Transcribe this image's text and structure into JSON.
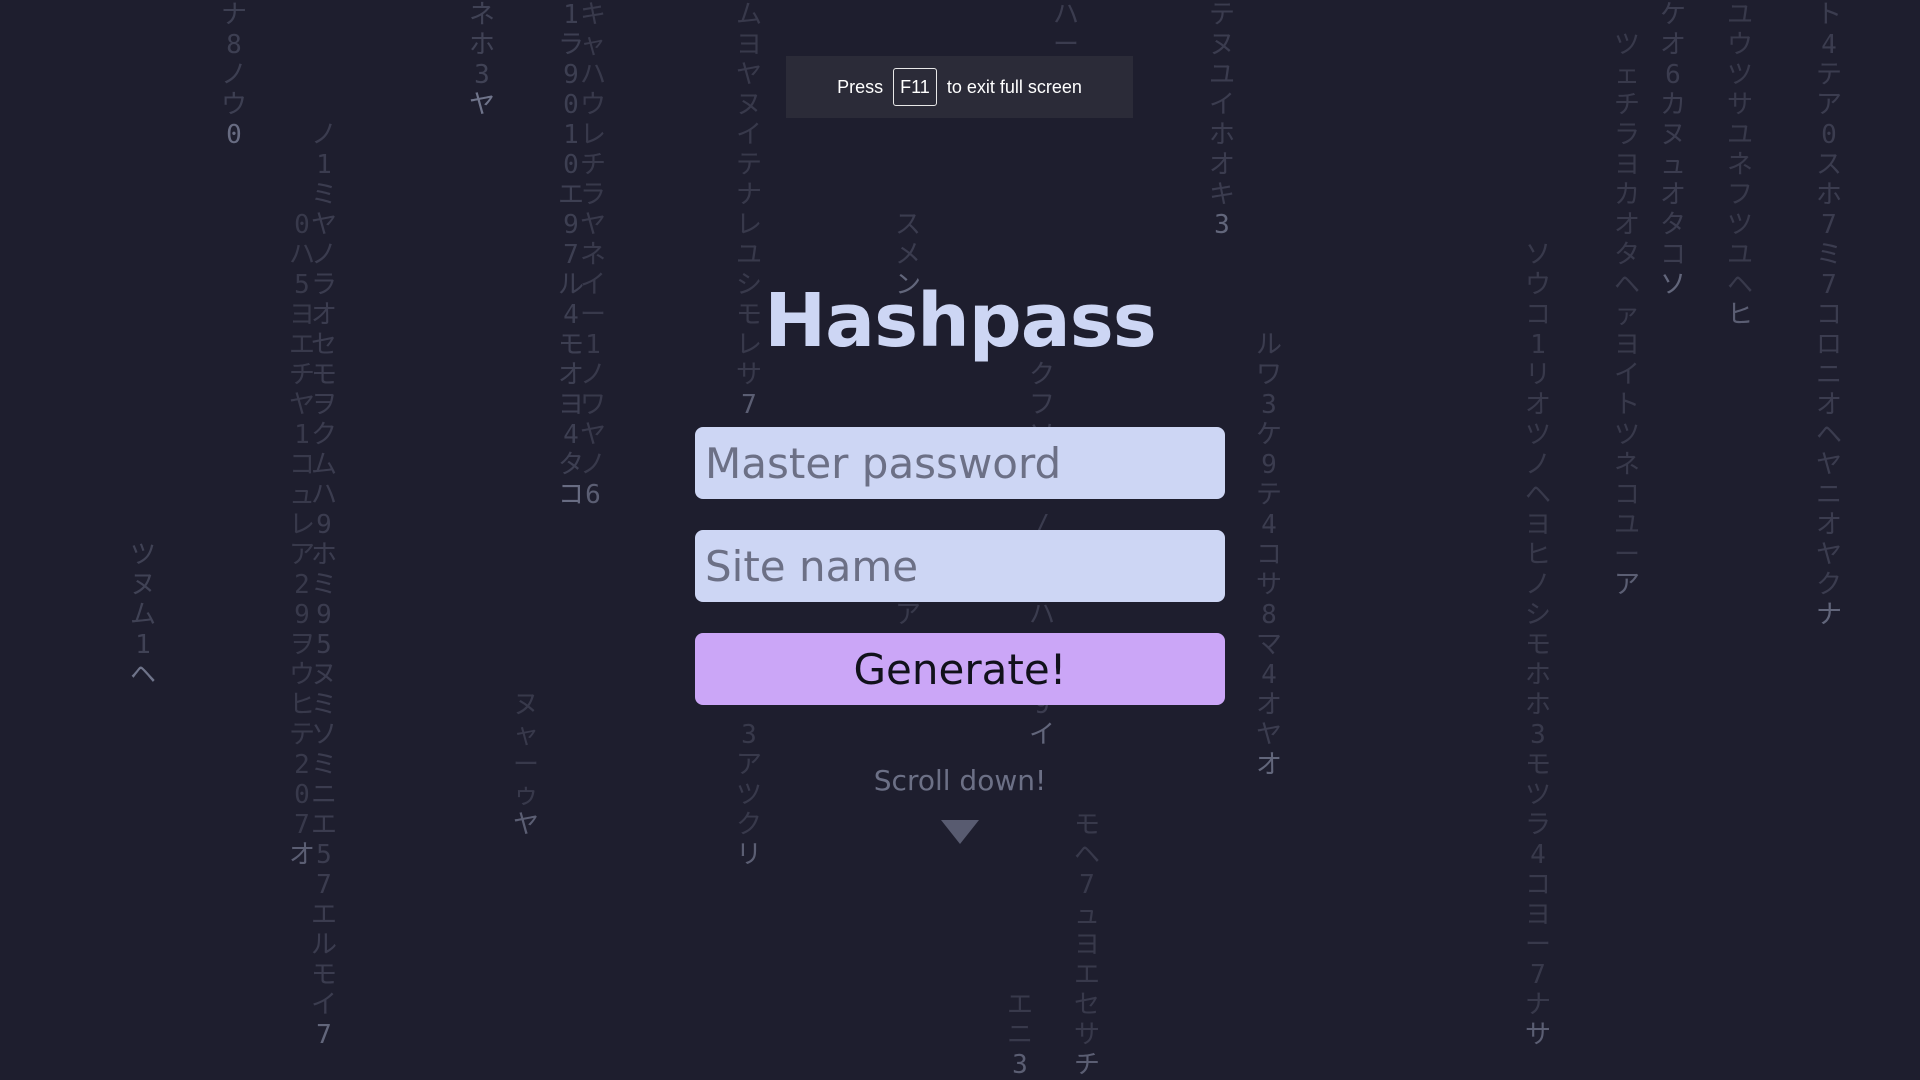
{
  "rain": {
    "color": "#585b70",
    "columns": [
      {
        "chars": "ツヌム1ヘ",
        "opacity": 0.6
      },
      {
        "chars": "ナ8ノウ0",
        "opacity": 0.55
      },
      {
        "chars": "0ハ5ヨエチヤ1コュレア29ヲウヒテ207オ",
        "opacity": 0.45
      },
      {
        "chars": "ノ1ミヤノラオセモヲクムハ9ホミ95ヌミソミニエ57エルモイ7",
        "opacity": 0.5
      },
      {
        "chars": "ネホ3ヤ",
        "opacity": 0.6
      },
      {
        "chars": "ヌャーゥヤ",
        "opacity": 0.45
      },
      {
        "chars": "1ラ9010エ97ル4モオヨ4タコ",
        "opacity": 0.55
      },
      {
        "chars": "キャハウレチラヤネイー1ノワヤノ6",
        "opacity": 0.45
      },
      {
        "chars": "ムヨヤヌイテナレユシモレサ7",
        "opacity": 0.45
      },
      {
        "chars": "3アツクリ",
        "opacity": 0.45
      },
      {
        "chars": "スメン",
        "opacity": 0.5
      },
      {
        "chars": "レアメア",
        "opacity": 0.45
      },
      {
        "chars": "ハー8ス",
        "opacity": 0.5
      },
      {
        "chars": "クフソトー/カムハエ29イ",
        "opacity": 0.5
      },
      {
        "chars": "エニ3",
        "opacity": 0.45
      },
      {
        "chars": "モヘ7ュヨエセサチ",
        "opacity": 0.45
      },
      {
        "chars": "テヌユイホオキ3",
        "opacity": 0.5
      },
      {
        "chars": "ルワ3ケ9テ4コサ8マ4オヤオ",
        "opacity": 0.5
      },
      {
        "chars": "ソウコ1リオツノヘヨヒノシモホホ3モツラ4コヨー7ナサ",
        "opacity": 0.45
      },
      {
        "chars": "ツェチラヨカオタヘァヨイトツネコユーア",
        "opacity": 0.45
      },
      {
        "chars": "ケオ6カヌュオタコソ",
        "opacity": 0.5
      },
      {
        "chars": "ユウツサユネフツユヘヒ",
        "opacity": 0.45
      },
      {
        "chars": "ト4テア0スホ7ミ7コロニオヘヤニオヤクナ",
        "opacity": 0.5
      }
    ]
  },
  "toast": {
    "before": "Press",
    "key": "F11",
    "after": "to exit full screen"
  },
  "app": {
    "title": "Hashpass",
    "master_placeholder": "Master password",
    "site_placeholder": "Site name",
    "generate_label": "Generate!",
    "scroll_hint": "Scroll down!"
  },
  "colors": {
    "background": "#1e1e2e",
    "title": "#cdd6f4",
    "input": "#cdd6f4",
    "button": "#cba6f7"
  }
}
